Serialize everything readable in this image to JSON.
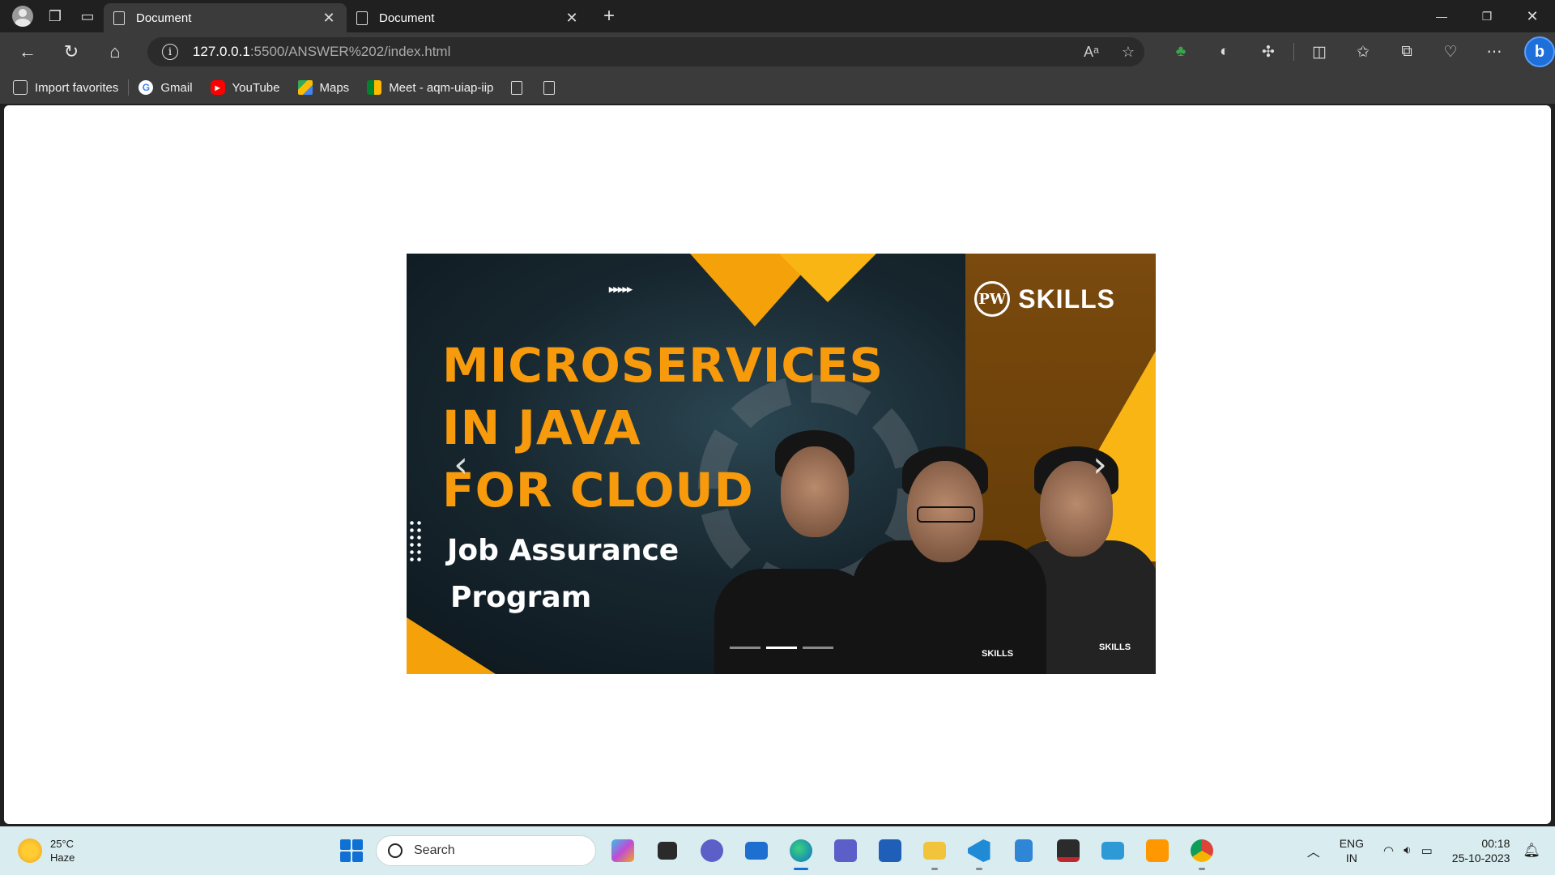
{
  "browser": {
    "tabs": [
      {
        "title": "Document",
        "active": true
      },
      {
        "title": "Document",
        "active": false
      }
    ],
    "new_tab_label": "+",
    "address": {
      "host": "127.0.0.1",
      "path": ":5500/ANSWER%202/index.html"
    },
    "favorites": [
      {
        "label": "Import favorites",
        "icon": "import-icon"
      },
      {
        "label": "Gmail",
        "icon": "google-icon"
      },
      {
        "label": "YouTube",
        "icon": "youtube-icon"
      },
      {
        "label": "Maps",
        "icon": "maps-icon"
      },
      {
        "label": "Meet - aqm-uiap-iip",
        "icon": "meet-icon"
      }
    ]
  },
  "carousel": {
    "arrows_top": "▸▸▸▸▸",
    "logo_mark": "PW",
    "logo_text": "SKILLS",
    "headline": [
      "MICROSERVICES",
      "IN JAVA",
      "FOR CLOUD"
    ],
    "subtitle": [
      "Job Assurance",
      "Program"
    ],
    "shirt_label": "SKILLS",
    "prev_label": "‹",
    "next_label": "›",
    "slide_count": 3,
    "active_index": 1
  },
  "taskbar": {
    "weather": {
      "temp": "25°C",
      "condition": "Haze"
    },
    "search_placeholder": "Search",
    "lang": {
      "line1": "ENG",
      "line2": "IN"
    },
    "clock": {
      "time": "00:18",
      "date": "25-10-2023"
    }
  },
  "colors": {
    "accent_orange": "#f79a0c",
    "browser_dark": "#202020",
    "toolbar": "#3b3b3b",
    "taskbar": "#d9ecef",
    "windows_blue": "#1170d4"
  }
}
